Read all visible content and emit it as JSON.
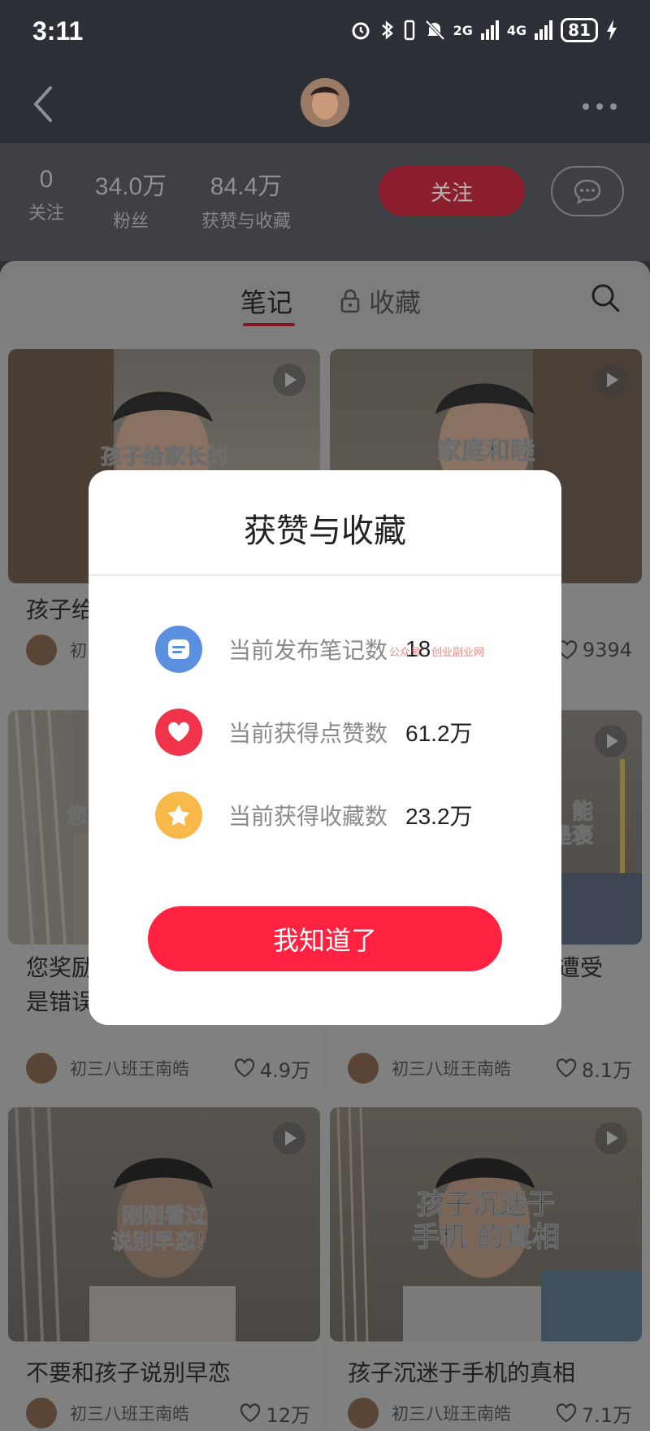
{
  "status_bar": {
    "time": "3:11",
    "network_2g": "2G",
    "network_4g": "4G",
    "battery": "81"
  },
  "profile": {
    "stats": [
      {
        "value": "0",
        "label": "关注"
      },
      {
        "value": "34.0万",
        "label": "粉丝"
      },
      {
        "value": "84.4万",
        "label": "获赞与收藏"
      }
    ],
    "follow_label": "关注"
  },
  "tabs": {
    "notes": "笔记",
    "collections": "收藏"
  },
  "cards": [
    {
      "overlay": "孩子给家长的",
      "title": "孩子给",
      "author": "初",
      "likes": ""
    },
    {
      "overlay": "家庭和睦",
      "title": "",
      "author": "",
      "likes": "9394"
    },
    {
      "overlay": "您",
      "title": "您奖励\n是错误",
      "author": "初三八班王南皓",
      "likes": "4.9万"
    },
    {
      "overlay": "能\n是褒",
      "title": "遭受",
      "author": "初三八班王南皓",
      "likes": "8.1万"
    },
    {
      "overlay": "刚刚看过\n说别早恋！",
      "title": "不要和孩子说别早恋",
      "author": "初三八班王南皓",
      "likes": "12万"
    },
    {
      "overlay": "孩子沉迷于\n手机 的真相",
      "title": "孩子沉迷于手机的真相",
      "author": "初三八班王南皓",
      "likes": "7.1万"
    }
  ],
  "modal": {
    "title": "获赞与收藏",
    "rows": [
      {
        "label": "当前发布笔记数",
        "value": "18",
        "icon": "note-icon",
        "color": "#5b8fe0"
      },
      {
        "label": "当前获得点赞数",
        "value": "61.2万",
        "icon": "heart-icon",
        "color": "#f0334a"
      },
      {
        "label": "当前获得收藏数",
        "value": "23.2万",
        "icon": "star-icon",
        "color": "#f8b84a"
      }
    ],
    "watermark": "公众号：创业副业网",
    "confirm": "我知道了"
  },
  "colors": {
    "accent": "#ff2341",
    "note_blue": "#5b8fe0",
    "heart_red": "#f0334a",
    "star_yellow": "#f8b84a"
  }
}
